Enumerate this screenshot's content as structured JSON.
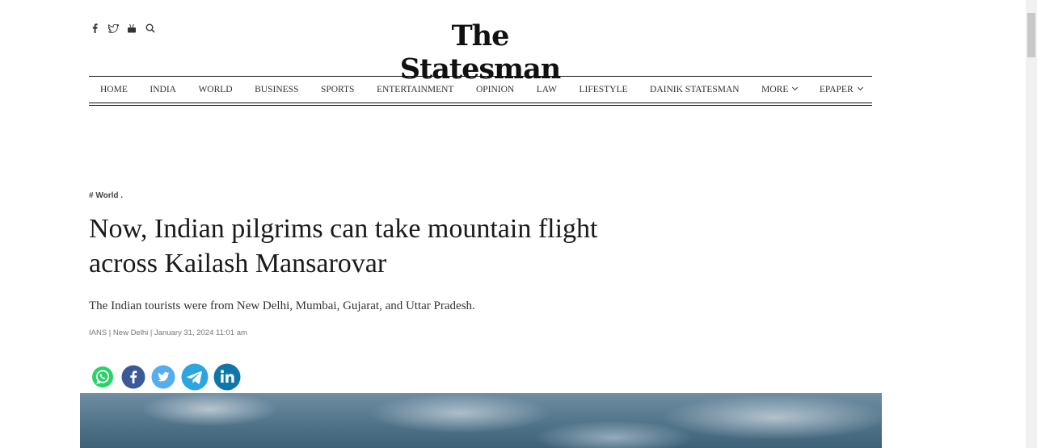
{
  "header": {
    "social_icons": [
      "facebook-icon",
      "twitter-icon",
      "youtube-icon",
      "search-icon"
    ],
    "logo_text": "The Statesman"
  },
  "nav": {
    "items": [
      {
        "label": "HOME"
      },
      {
        "label": "INDIA"
      },
      {
        "label": "WORLD"
      },
      {
        "label": "BUSINESS"
      },
      {
        "label": "SPORTS"
      },
      {
        "label": "ENTERTAINMENT"
      },
      {
        "label": "OPINION"
      },
      {
        "label": "LAW"
      },
      {
        "label": "LIFESTYLE"
      },
      {
        "label": "DAINIK STATESMAN"
      },
      {
        "label": "MORE"
      },
      {
        "label": "EPAPER"
      }
    ]
  },
  "article": {
    "tag": "# World .",
    "headline": "Now, Indian pilgrims can take mountain flight across Kailash Mansarovar",
    "dek": "The Indian tourists were from New Delhi, Mumbai, Gujarat, and Uttar Pradesh.",
    "byline": "IANS | New Delhi | January 31, 2024 11:01 am"
  },
  "share": {
    "buttons": [
      "whatsapp-icon",
      "facebook-icon",
      "twitter-icon",
      "telegram-icon",
      "linkedin-icon"
    ],
    "colors": {
      "whatsapp": "#25d366",
      "facebook": "#3b5998",
      "twitter": "#55acee",
      "telegram": "#2ca5e0",
      "linkedin": "#0e76a8"
    }
  }
}
